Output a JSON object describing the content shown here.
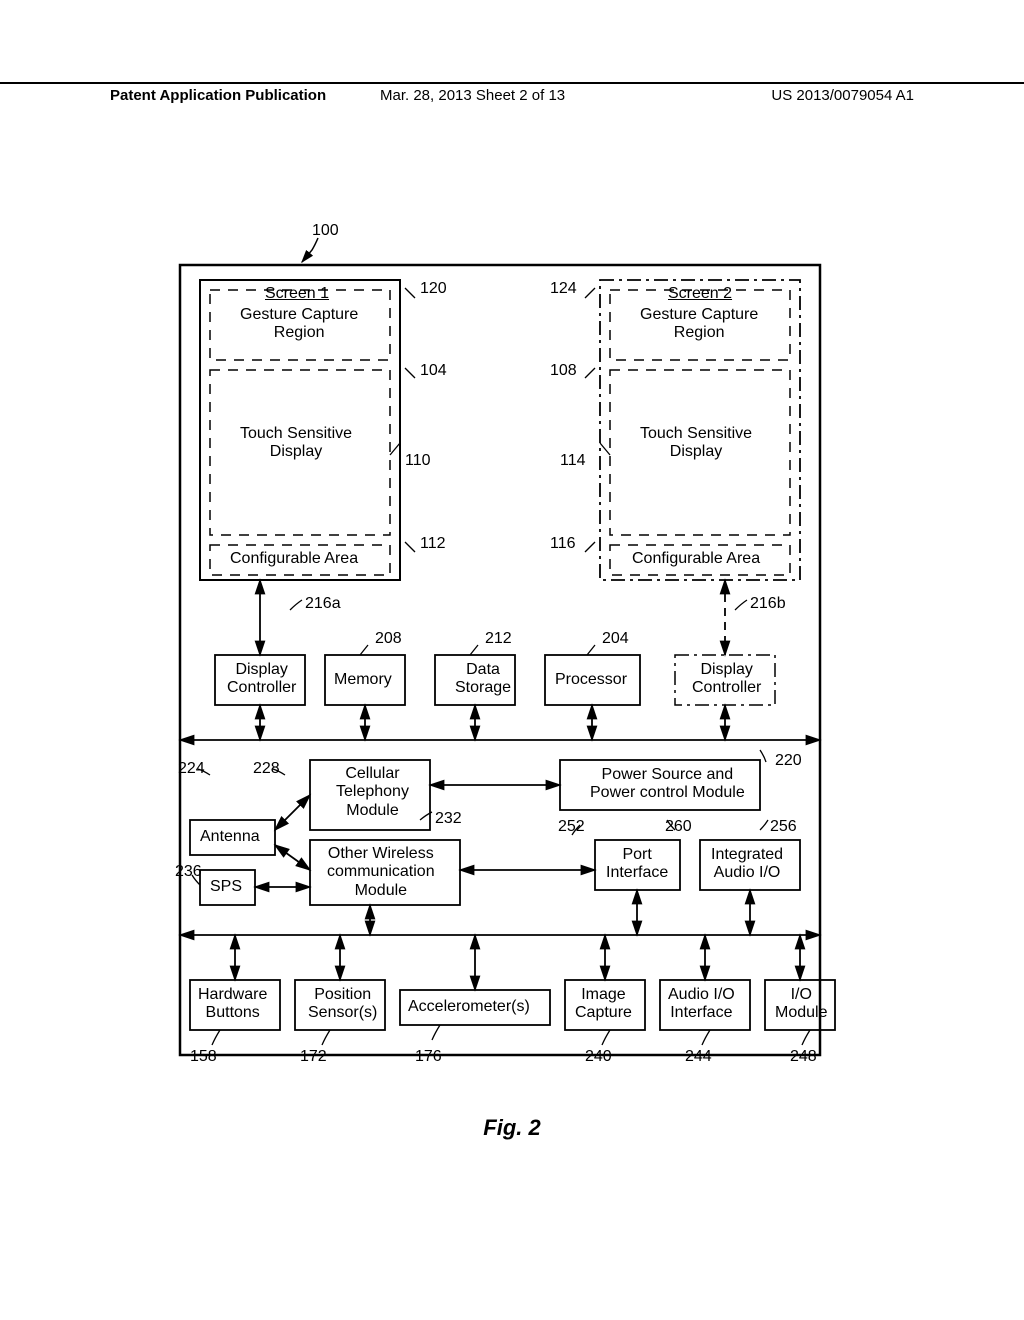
{
  "header": {
    "left": "Patent Application Publication",
    "mid": "Mar. 28, 2013  Sheet 2 of 13",
    "right": "US 2013/0079054 A1"
  },
  "figure": {
    "ref_100": "100",
    "screen1": {
      "title": "Screen 1",
      "gesture": "Gesture Capture\nRegion",
      "touch": "Touch Sensitive\nDisplay",
      "config": "Configurable Area"
    },
    "screen2": {
      "title": "Screen 2",
      "gesture": "Gesture Capture\nRegion",
      "touch": "Touch Sensitive\nDisplay",
      "config": "Configurable Area"
    },
    "refs": {
      "r120": "120",
      "r124": "124",
      "r104": "104",
      "r108": "108",
      "r110": "110",
      "r114": "114",
      "r112": "112",
      "r116": "116",
      "r216a": "216a",
      "r216b": "216b",
      "r208": "208",
      "r212": "212",
      "r204": "204",
      "r224": "224",
      "r228": "228",
      "r220": "220",
      "r232": "232",
      "r252": "252",
      "r260": "260",
      "r256": "256",
      "r236": "236",
      "r158": "158",
      "r172": "172",
      "r176": "176",
      "r240": "240",
      "r244": "244",
      "r248": "248"
    },
    "blocks": {
      "disp_ctrl1": "Display\nController",
      "memory": "Memory",
      "data_storage": "Data\nStorage",
      "processor": "Processor",
      "disp_ctrl2": "Display\nController",
      "cellular": "Cellular\nTelephony\nModule",
      "power": "Power Source and\nPower control Module",
      "antenna": "Antenna",
      "other_wireless": "Other Wireless\ncommunication\nModule",
      "port_if": "Port\nInterface",
      "int_audio": "Integrated\nAudio I/O",
      "sps": "SPS",
      "hw_buttons": "Hardware\nButtons",
      "pos_sensors": "Position\nSensor(s)",
      "accel": "Accelerometer(s)",
      "img_capture": "Image\nCapture",
      "audio_if": "Audio I/O\nInterface",
      "io_module": "I/O\nModule"
    },
    "caption": "Fig. 2"
  }
}
